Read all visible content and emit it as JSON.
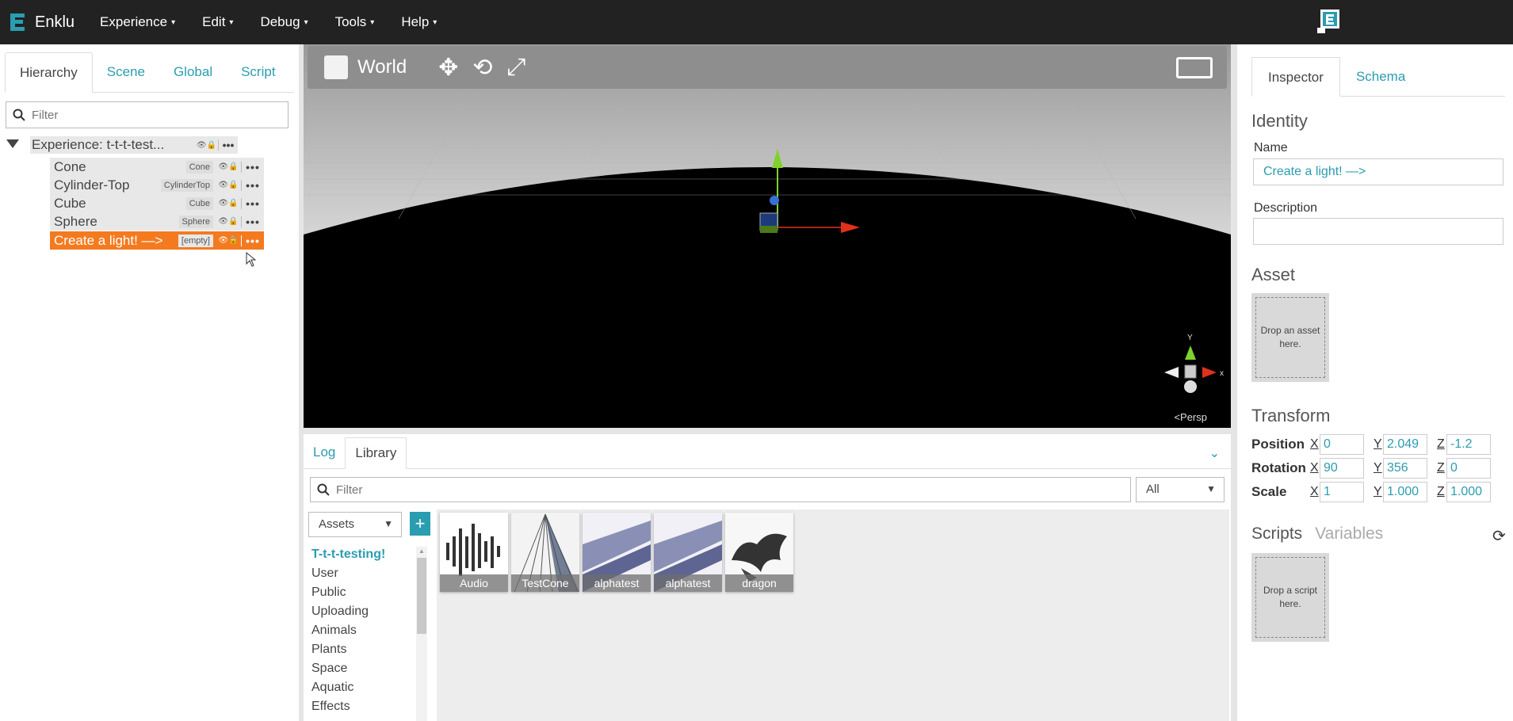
{
  "topbar": {
    "brand": "Enklu",
    "menus": [
      "Experience",
      "Edit",
      "Debug",
      "Tools",
      "Help"
    ]
  },
  "left": {
    "tabs": [
      "Hierarchy",
      "Scene",
      "Global",
      "Script"
    ],
    "filter_placeholder": "Filter",
    "root": "Experience: t-t-t-test...",
    "nodes": [
      {
        "name": "Cone",
        "tag": "Cone"
      },
      {
        "name": "Cylinder-Top",
        "tag": "CylinderTop"
      },
      {
        "name": "Cube",
        "tag": "Cube"
      },
      {
        "name": "Sphere",
        "tag": "Sphere"
      },
      {
        "name": "Create a light! —>",
        "tag": "[empty]"
      }
    ]
  },
  "viewport": {
    "mode": "World",
    "persp": "Persp"
  },
  "bottom": {
    "tabs": [
      "Log",
      "Library"
    ],
    "filter_placeholder": "Filter",
    "scope": "All",
    "assets_select": "Assets",
    "plus": "+",
    "categories": [
      "T-t-t-testing!",
      "User",
      "Public",
      "Uploading",
      "Animals",
      "Plants",
      "Space",
      "Aquatic",
      "Effects"
    ],
    "assets": [
      "Audio",
      "TestCone",
      "alphatest",
      "alphatest",
      "dragon"
    ]
  },
  "inspector": {
    "tabs": [
      "Inspector",
      "Schema"
    ],
    "identity": "Identity",
    "name_label": "Name",
    "name_value": "Create a light! —>",
    "description_label": "Description",
    "description_value": "",
    "asset": "Asset",
    "asset_drop": "Drop an asset here.",
    "transform": "Transform",
    "position_label": "Position",
    "rotation_label": "Rotation",
    "scale_label": "Scale",
    "position": [
      "0",
      "2.049",
      "-1.2"
    ],
    "rotation": [
      "90",
      "356",
      "0"
    ],
    "scale": [
      "1",
      "1.000",
      "1.000"
    ],
    "axes": [
      "X",
      "Y",
      "Z"
    ],
    "scripts_tab": "Scripts",
    "variables_tab": "Variables",
    "script_drop": "Drop a script here."
  },
  "colors": {
    "accent": "#2a9db0",
    "selection": "#f47a20",
    "topbar": "#222222"
  }
}
